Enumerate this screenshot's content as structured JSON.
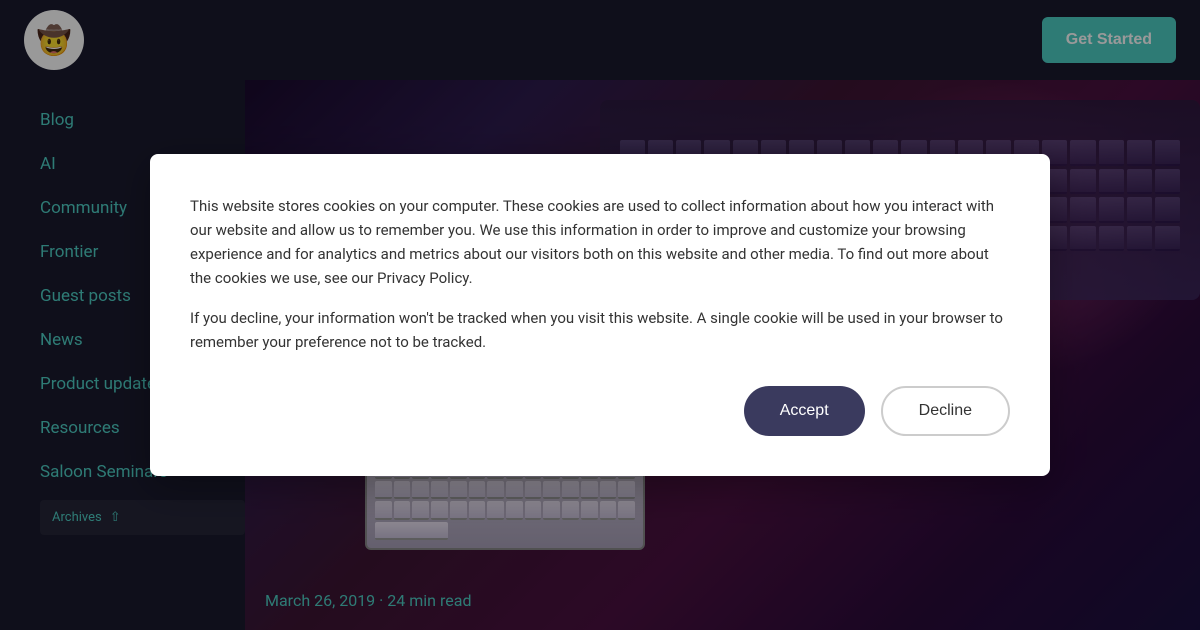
{
  "header": {
    "logo_icon": "🤠",
    "get_started_label": "Get Started"
  },
  "sidebar": {
    "nav_items": [
      {
        "label": "Blog",
        "href": "#"
      },
      {
        "label": "AI",
        "href": "#"
      },
      {
        "label": "Community",
        "href": "#"
      },
      {
        "label": "Frontier",
        "href": "#"
      },
      {
        "label": "Guest posts",
        "href": "#"
      },
      {
        "label": "News",
        "href": "#"
      },
      {
        "label": "Product updates",
        "href": "#"
      },
      {
        "label": "Resources",
        "href": "#"
      },
      {
        "label": "Saloon Seminars",
        "href": "#"
      }
    ],
    "archives_label": "Archives",
    "archives_icon": "chevron-up"
  },
  "article": {
    "date": "March 26, 2019",
    "read_time": "24 min read",
    "separator": "·"
  },
  "cookie": {
    "primary_text": "This website stores cookies on your computer. These cookies are used to collect information about how you interact with our website and allow us to remember you. We use this information in order to improve and customize your browsing experience and for analytics and metrics about our visitors both on this website and other media. To find out more about the cookies we use, see our Privacy Policy.",
    "secondary_text": "If you decline, your information won't be tracked when you visit this website. A single cookie will be used in your browser to remember your preference not to be tracked.",
    "accept_label": "Accept",
    "decline_label": "Decline"
  }
}
